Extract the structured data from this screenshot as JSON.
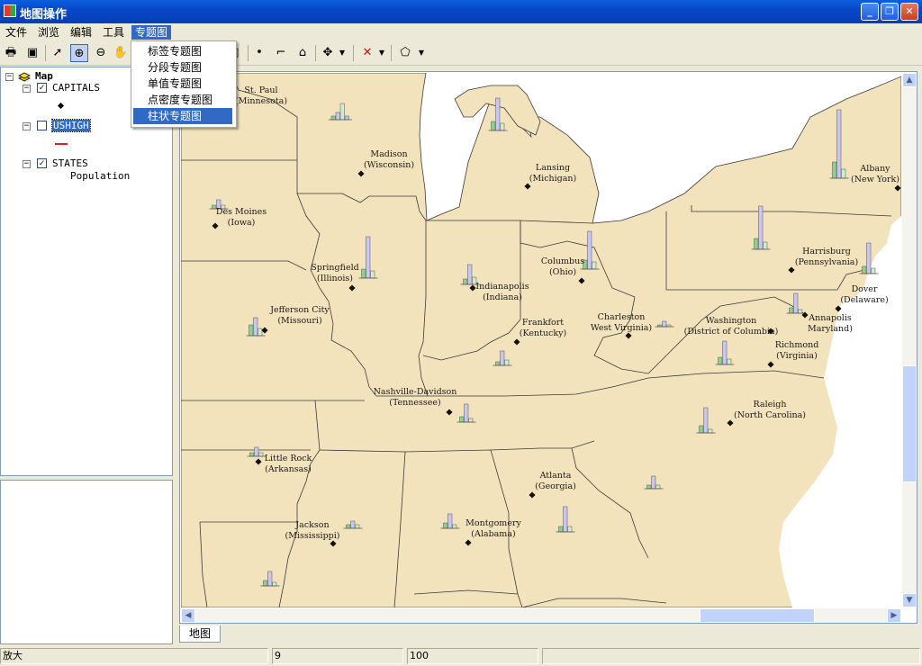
{
  "window": {
    "title": "地图操作"
  },
  "menu": {
    "items": [
      "文件",
      "浏览",
      "编辑",
      "工具",
      "专题图"
    ],
    "active_index": 4
  },
  "dropdown": {
    "items": [
      "标签专题图",
      "分段专题图",
      "单值专题图",
      "点密度专题图",
      "柱状专题图"
    ],
    "highlight_index": 4
  },
  "toc": {
    "root": "Map",
    "layers": [
      {
        "name": "CAPITALS",
        "checked": true
      },
      {
        "name": "USHIGH",
        "checked": false,
        "selected": true
      },
      {
        "name": "STATES",
        "checked": true,
        "legend": "Population"
      }
    ]
  },
  "map": {
    "land_color": "#f3e3bd",
    "water_color": "#ffffff",
    "border_color": "#3a3a3a",
    "cities": [
      {
        "name": "St. Paul",
        "state": "(Minnesota)"
      },
      {
        "name": "Madison",
        "state": "(Wisconsin)"
      },
      {
        "name": "Lansing",
        "state": "(Michigan)"
      },
      {
        "name": "Albany",
        "state": "(New York)"
      },
      {
        "name": "Des Moines",
        "state": "(Iowa)"
      },
      {
        "name": "Springfield",
        "state": "(Illinois)"
      },
      {
        "name": "Indianapolis",
        "state": "(Indiana)"
      },
      {
        "name": "Columbus",
        "state": "(Ohio)"
      },
      {
        "name": "Harrisburg",
        "state": "(Pennsylvania)"
      },
      {
        "name": "Dover",
        "state": "(Delaware)"
      },
      {
        "name": "Annapolis",
        "state": "Maryland)"
      },
      {
        "name": "Jefferson City",
        "state": "(Missouri)"
      },
      {
        "name": "Frankfort",
        "state": "(Kentucky)"
      },
      {
        "name": "Charleston",
        "state": "West Virginia)"
      },
      {
        "name": "Washington",
        "state": "(District of Columbia)"
      },
      {
        "name": "Richmond",
        "state": "(Virginia)"
      },
      {
        "name": "Nashville-Davidson",
        "state": "(Tennessee)"
      },
      {
        "name": "Raleigh",
        "state": "(North Carolina)"
      },
      {
        "name": "Little Rock",
        "state": "(Arkansas)"
      },
      {
        "name": "Atlanta",
        "state": "(Georgia)"
      },
      {
        "name": "Jackson",
        "state": "(Mississippi)"
      },
      {
        "name": "Montgomery",
        "state": "(Alabama)"
      }
    ]
  },
  "tabs": [
    "地图"
  ],
  "status": {
    "mode": "放大",
    "value1": "9",
    "value2": "100"
  }
}
